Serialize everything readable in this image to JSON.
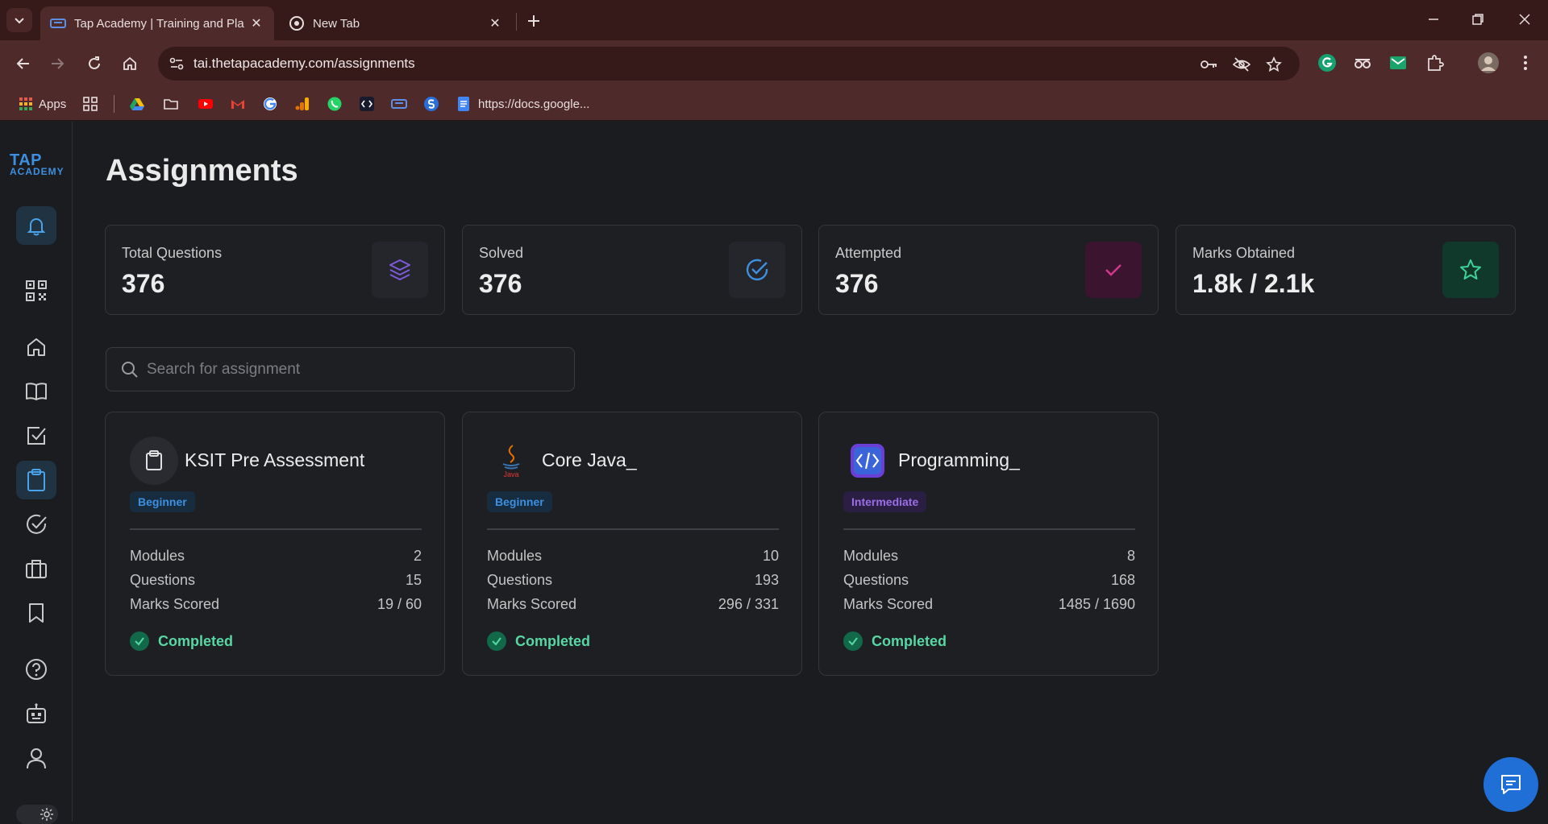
{
  "browser": {
    "tabs": [
      {
        "title": "Tap Academy | Training and Pla",
        "active": true
      },
      {
        "title": "New Tab",
        "active": false
      }
    ],
    "url": "tai.thetapacademy.com/assignments",
    "bookmarks": {
      "apps_label": "Apps",
      "docs_label": "https://docs.google..."
    }
  },
  "sidebar": {
    "logo_line1": "TAP",
    "logo_line2": "ACADEMY",
    "items": [
      {
        "name": "notifications",
        "icon": "bell-icon",
        "active": false
      },
      {
        "name": "qr",
        "icon": "qr-code-icon"
      },
      {
        "name": "home",
        "icon": "home-icon"
      },
      {
        "name": "courses",
        "icon": "book-icon"
      },
      {
        "name": "tasks",
        "icon": "checkbox-icon"
      },
      {
        "name": "assignments",
        "icon": "clipboard-icon",
        "active": true
      },
      {
        "name": "completed",
        "icon": "check-circle-icon"
      },
      {
        "name": "jobs",
        "icon": "briefcase-icon"
      },
      {
        "name": "saved",
        "icon": "bookmark-icon"
      },
      {
        "name": "help",
        "icon": "help-icon"
      },
      {
        "name": "bot",
        "icon": "robot-icon"
      },
      {
        "name": "profile",
        "icon": "user-icon"
      }
    ]
  },
  "page": {
    "title": "Assignments",
    "stats": [
      {
        "label": "Total Questions",
        "value": "376",
        "icon": "layers-icon",
        "color": "#7c5cd6"
      },
      {
        "label": "Solved",
        "value": "376",
        "icon": "check-circle-icon",
        "color": "#3d8fe0"
      },
      {
        "label": "Attempted",
        "value": "376",
        "icon": "check-icon",
        "color": "#d6378a"
      },
      {
        "label": "Marks Obtained",
        "value": "1.8k / 2.1k",
        "icon": "star-icon",
        "color": "#3fd29a"
      }
    ],
    "search": {
      "placeholder": "Search for assignment",
      "value": ""
    },
    "row_labels": {
      "modules": "Modules",
      "questions": "Questions",
      "marks": "Marks Scored"
    },
    "assignments": [
      {
        "title": "KSIT Pre Assessment",
        "icon": "clipboard-icon",
        "level": "Beginner",
        "modules": "2",
        "questions": "15",
        "marks": "19 / 60",
        "status": "Completed"
      },
      {
        "title": "Core Java_",
        "icon": "java-logo-icon",
        "java_caption": "Java",
        "level": "Beginner",
        "modules": "10",
        "questions": "193",
        "marks": "296 / 331",
        "status": "Completed"
      },
      {
        "title": "Programming_",
        "icon": "code-icon",
        "level": "Intermediate",
        "modules": "8",
        "questions": "168",
        "marks": "1485 / 1690",
        "status": "Completed"
      }
    ]
  },
  "colors": {
    "beginner": "#3d8fe0",
    "intermediate": "#9b6ee8",
    "completed": "#58d7a4",
    "accent": "#1f6fd6"
  }
}
